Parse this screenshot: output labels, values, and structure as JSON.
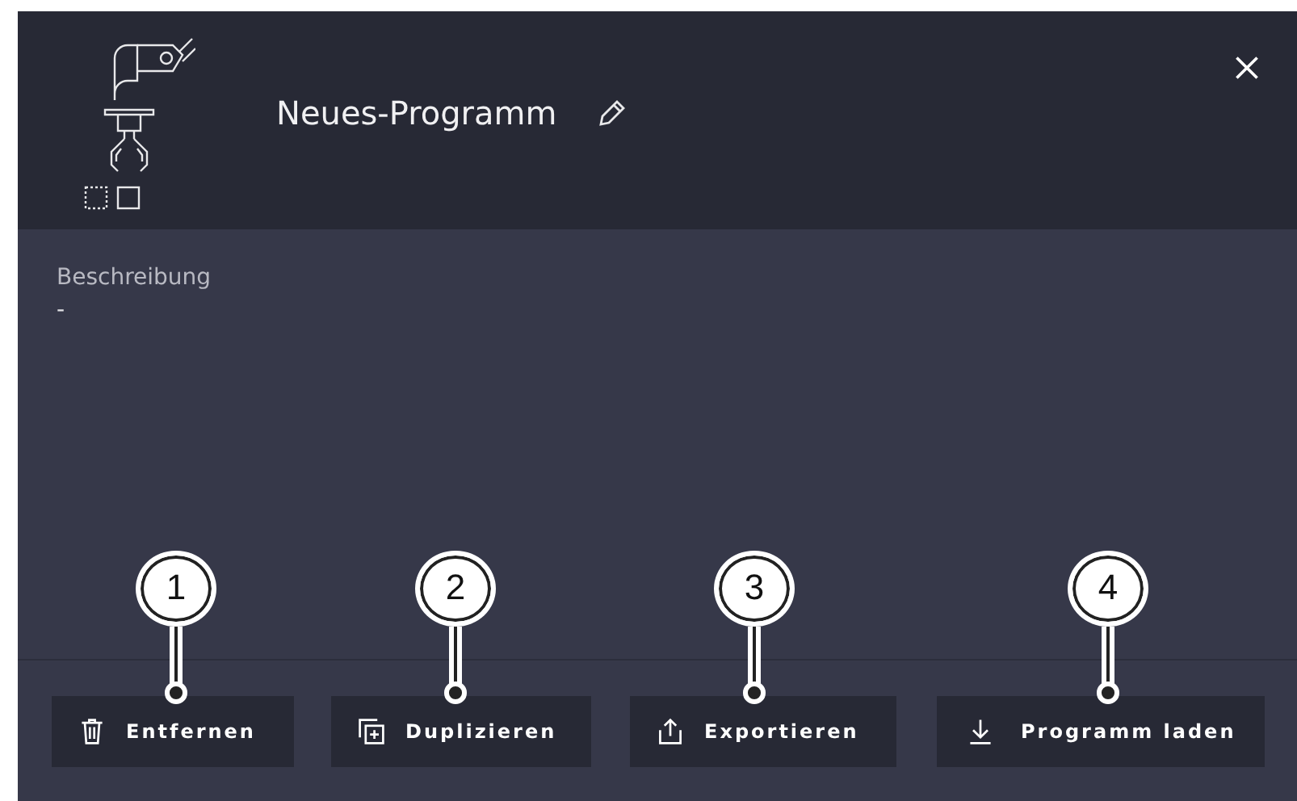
{
  "header": {
    "title": "Neues-Programm"
  },
  "description": {
    "label": "Beschreibung",
    "value": "-"
  },
  "buttons": [
    {
      "kind": "delete",
      "label": "Entfernen",
      "callout": "1"
    },
    {
      "kind": "duplicate",
      "label": "Duplizieren",
      "callout": "2"
    },
    {
      "kind": "export",
      "label": "Exportieren",
      "callout": "3"
    },
    {
      "kind": "load",
      "label": "Programm laden",
      "callout": "4"
    }
  ]
}
